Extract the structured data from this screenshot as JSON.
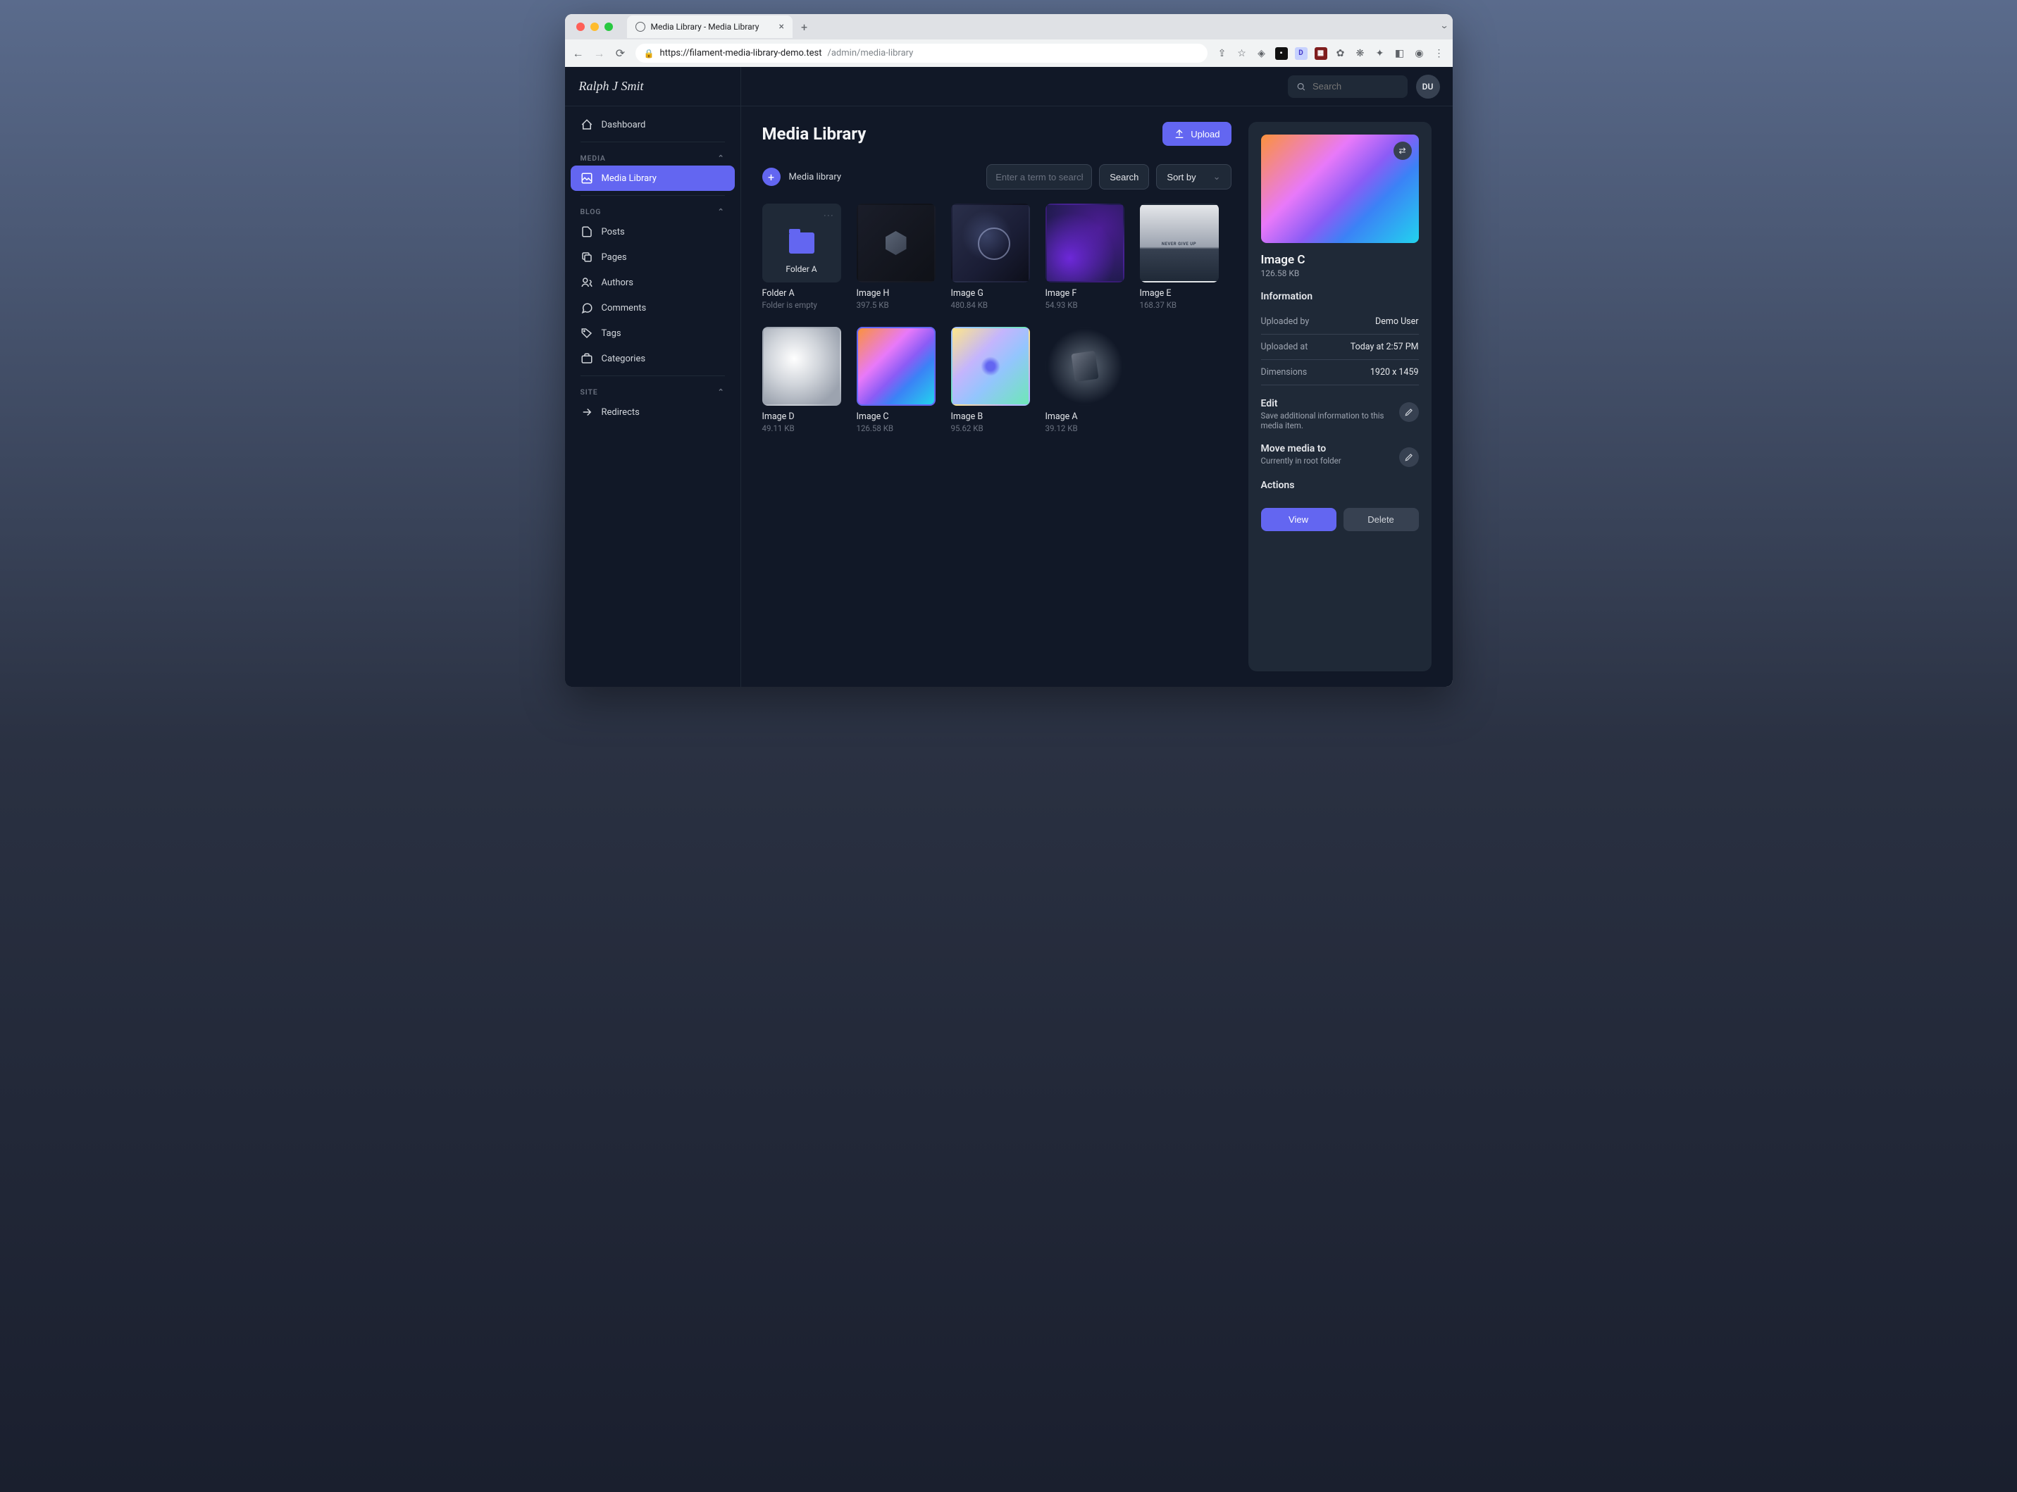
{
  "browser": {
    "tab_title": "Media Library - Media Library",
    "url_host": "https://filament-media-library-demo.test",
    "url_path": "/admin/media-library"
  },
  "logo_text": "Ralph J Smit",
  "sidebar": {
    "dashboard": "Dashboard",
    "groups": {
      "media": {
        "label": "MEDIA",
        "items": {
          "media_library": "Media Library"
        }
      },
      "blog": {
        "label": "BLOG",
        "items": {
          "posts": "Posts",
          "pages": "Pages",
          "authors": "Authors",
          "comments": "Comments",
          "tags": "Tags",
          "categories": "Categories"
        }
      },
      "site": {
        "label": "SITE",
        "items": {
          "redirects": "Redirects"
        }
      }
    }
  },
  "topbar": {
    "search_placeholder": "Search",
    "avatar_initials": "DU"
  },
  "page": {
    "title": "Media Library",
    "upload_label": "Upload",
    "breadcrumb": "Media library",
    "search_placeholder": "Enter a term to search",
    "search_button": "Search",
    "sort_label": "Sort by"
  },
  "grid": [
    {
      "id": "folderA",
      "type": "folder",
      "name": "Folder A",
      "meta": "Folder is empty",
      "thumb_label": "Folder A"
    },
    {
      "id": "imgH",
      "type": "image",
      "name": "Image H",
      "meta": "397.5 KB",
      "thumb": "h"
    },
    {
      "id": "imgG",
      "type": "image",
      "name": "Image G",
      "meta": "480.84 KB",
      "thumb": "g"
    },
    {
      "id": "imgF",
      "type": "image",
      "name": "Image F",
      "meta": "54.93 KB",
      "thumb": "f"
    },
    {
      "id": "imgE",
      "type": "image",
      "name": "Image E",
      "meta": "168.37 KB",
      "thumb": "e"
    },
    {
      "id": "imgD",
      "type": "image",
      "name": "Image D",
      "meta": "49.11 KB",
      "thumb": "d"
    },
    {
      "id": "imgC",
      "type": "image",
      "name": "Image C",
      "meta": "126.58 KB",
      "thumb": "c",
      "selected": true
    },
    {
      "id": "imgB",
      "type": "image",
      "name": "Image B",
      "meta": "95.62 KB",
      "thumb": "b"
    },
    {
      "id": "imgA",
      "type": "image",
      "name": "Image A",
      "meta": "39.12 KB",
      "thumb": "a"
    }
  ],
  "detail": {
    "title": "Image C",
    "size": "126.58 KB",
    "info_heading": "Information",
    "rows": {
      "uploaded_by": {
        "label": "Uploaded by",
        "value": "Demo User"
      },
      "uploaded_at": {
        "label": "Uploaded at",
        "value": "Today at 2:57 PM"
      },
      "dimensions": {
        "label": "Dimensions",
        "value": "1920 x 1459"
      }
    },
    "edit": {
      "title": "Edit",
      "desc": "Save additional information to this media item."
    },
    "move": {
      "title": "Move media to",
      "desc": "Currently in root folder"
    },
    "actions_heading": "Actions",
    "view_label": "View",
    "delete_label": "Delete"
  }
}
